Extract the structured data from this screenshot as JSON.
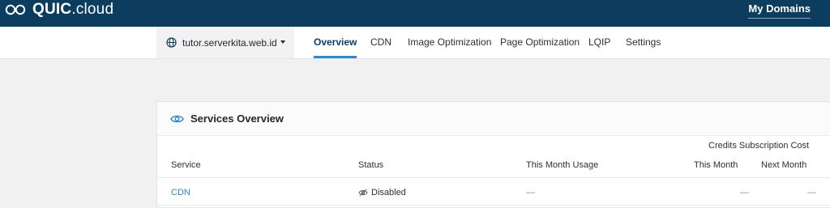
{
  "brand": {
    "name_bold": "QUIC",
    "name_rest": ".cloud"
  },
  "header": {
    "my_domains": "My Domains"
  },
  "domain_select": {
    "value": "tutor.serverkita.web.id"
  },
  "tabs": [
    {
      "label": "Overview",
      "active": true
    },
    {
      "label": "CDN",
      "active": false
    },
    {
      "label": "Image Optimization",
      "active": false
    },
    {
      "label": "Page Optimization",
      "active": false
    },
    {
      "label": "LQIP",
      "active": false
    },
    {
      "label": "Settings",
      "active": false
    }
  ],
  "services": {
    "title": "Services Overview",
    "group_header": "Credits Subscription Cost",
    "columns": [
      "Service",
      "Status",
      "This Month Usage",
      "This Month",
      "Next Month"
    ],
    "rows": [
      {
        "service": "CDN",
        "status": "Disabled",
        "usage": "—",
        "this_month": "—",
        "next_month": "—"
      }
    ]
  },
  "colors": {
    "topbar": "#0d3d5e",
    "accent": "#2f86c9",
    "background": "#f1f1f1"
  }
}
